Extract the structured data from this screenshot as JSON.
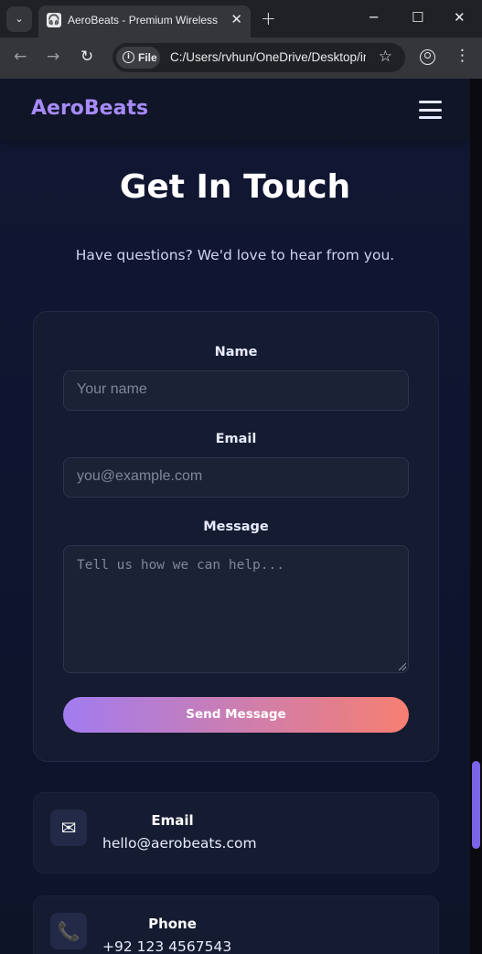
{
  "browser": {
    "tab_title": "AeroBeats - Premium Wireless Headphones",
    "tab_menu_icon": "chevron-down-icon",
    "new_tab_symbol": "+",
    "close_symbol": "✕",
    "minimize_symbol": "─",
    "maximize_symbol": "☐",
    "window_close_symbol": "✕",
    "back_symbol": "←",
    "forward_symbol": "→",
    "reload_symbol": "↻",
    "site_info_label": "File",
    "url": "C:/Users/rvhun/OneDrive/Desktop/index.html",
    "star_symbol": "☆",
    "menu_symbol": "⋮"
  },
  "navbar": {
    "logo": "AeroBeats"
  },
  "contact": {
    "title": "Get In Touch",
    "subtitle": "Have questions? We'd love to hear from you.",
    "form": {
      "name_label": "Name",
      "name_placeholder": "Your name",
      "email_label": "Email",
      "email_placeholder": "you@example.com",
      "message_label": "Message",
      "message_placeholder": "Tell us how we can help...",
      "submit_label": "Send Message"
    },
    "info": [
      {
        "icon": "envelope-icon",
        "glyph": "✉",
        "title": "Email",
        "value": "hello@aerobeats.com"
      },
      {
        "icon": "phone-icon",
        "glyph": "📞",
        "title": "Phone",
        "value": "+92 123 4567543"
      }
    ]
  },
  "colors": {
    "accent": "#a78bfa",
    "button_gradient_start": "#a17cf0",
    "button_gradient_end": "#f67f72",
    "background": "#0f1424",
    "card": "#151b30"
  }
}
